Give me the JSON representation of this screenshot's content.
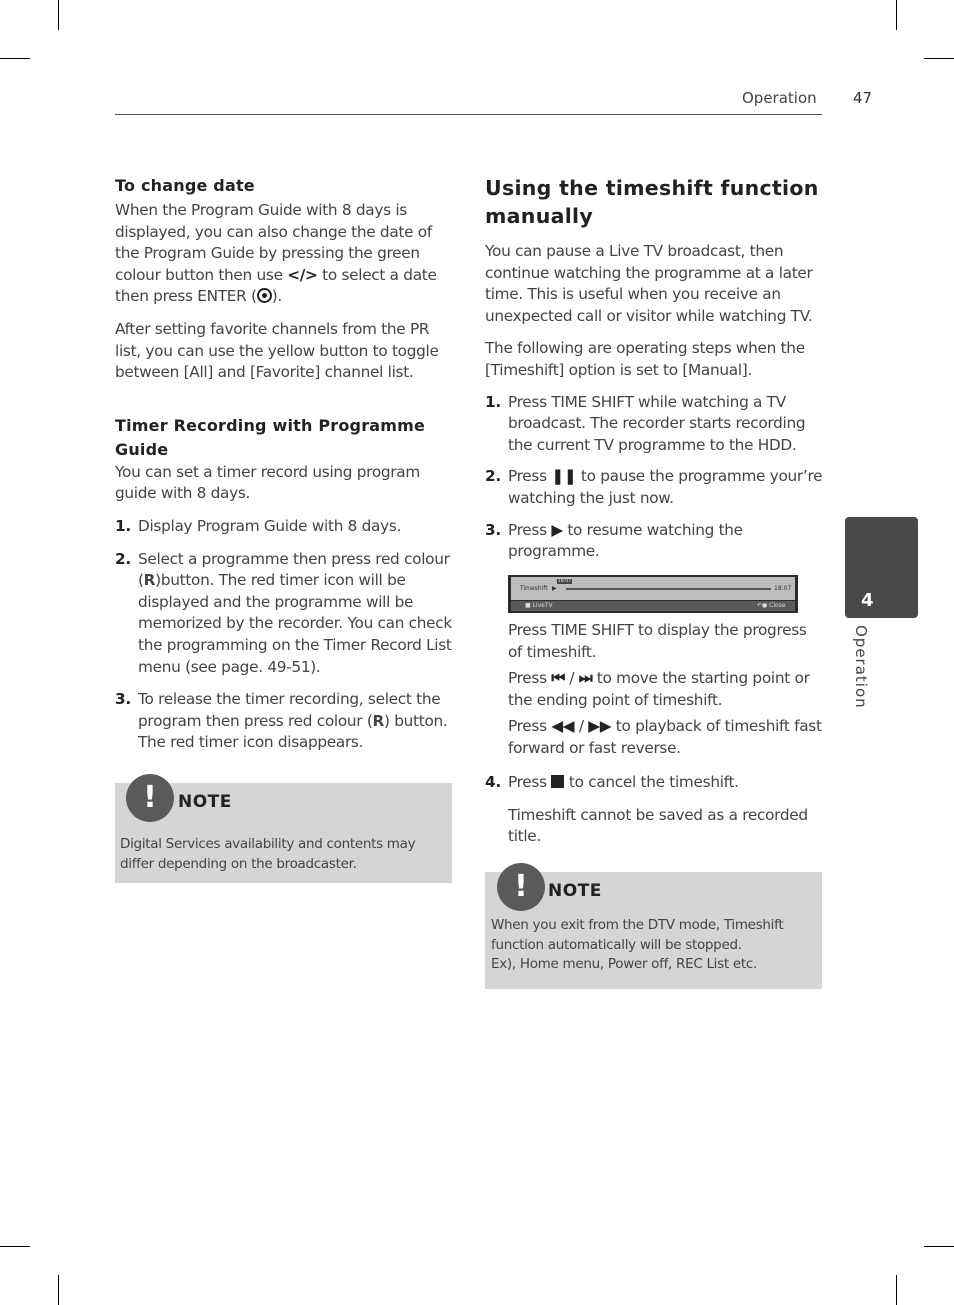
{
  "header": {
    "section": "Operation",
    "page_number": "47"
  },
  "side_tab": {
    "number": "4",
    "label": "Operation"
  },
  "left": {
    "change_date": {
      "heading": "To change date",
      "para1_a": "When the Program Guide with 8 days is displayed, you can also change the date of the Program Guide by pressing the green colour button then use ",
      "para1_glyph": "</>",
      "para1_b": " to select a date then press ENTER (",
      "para1_c": ").",
      "para2": "After setting favorite channels from the PR list, you can use the yellow button to toggle between [All] and [Favorite] channel list."
    },
    "timer": {
      "heading": "Timer Recording with Programme Guide",
      "intro": "You can set a timer record using program guide with 8 days.",
      "steps": [
        {
          "num": "1.",
          "text": "Display Program Guide with 8 days."
        },
        {
          "num": "2.",
          "a": "Select a programme then press red colour (",
          "key": "R",
          "b": ")button. The red timer icon will be displayed and the programme will be memorized by the recorder. You can check the programming on the Timer Record List menu (see page. 49-51)."
        },
        {
          "num": "3.",
          "a": "To release the timer recording, select the program then press red colour (",
          "key": "R",
          "b": ") button. The red timer icon disappears."
        }
      ]
    },
    "note": {
      "icon": "!",
      "title": "NOTE",
      "text": "Digital Services availability and contents may differ depending on the broadcaster."
    }
  },
  "right": {
    "heading": "Using the timeshift function manually",
    "para1": "You can pause a Live TV broadcast, then continue watching the programme at a later time. This is useful when you receive an unexpected call or visitor while watching TV.",
    "para2": "The following are operating steps when the [Timeshift] option is set to [Manual].",
    "steps": [
      {
        "num": "1.",
        "text": "Press TIME SHIFT while watching a TV broadcast. The recorder starts recording the current TV programme to the HDD."
      },
      {
        "num": "2.",
        "a": "Press ",
        "glyph": "❚❚",
        "b": " to pause the programme your’re watching the just now."
      },
      {
        "num": "3.",
        "a": "Press ",
        "glyph": "▶",
        "b": " to resume watching the programme."
      }
    ],
    "osd": {
      "label": "Timeshift",
      "play": "▶",
      "marker": "18:07",
      "time": "18:07",
      "live": "■  LiveTV",
      "close": "↶● Close",
      "progress": 0.02
    },
    "sub": [
      {
        "text": "Press TIME SHIFT to display the progress of timeshift."
      },
      {
        "a": "Press ",
        "glyph1": "⏮",
        "sep": " / ",
        "glyph2": "⏭",
        "b": " to move the starting point or the ending point of timeshift."
      },
      {
        "a": "Press ",
        "glyph1": "◀◀",
        "sep": " / ",
        "glyph2": "▶▶",
        "b": " to playback of timeshift fast forward or fast reverse."
      }
    ],
    "step4": {
      "num": "4.",
      "a": "Press ",
      "b": " to cancel the timeshift."
    },
    "step4_note": "Timeshift cannot be saved as a recorded title.",
    "note": {
      "icon": "!",
      "title": "NOTE",
      "line1": "When you exit from the DTV mode, Timeshift",
      "line2": "function automatically will be stopped.",
      "line3": "Ex), Home menu, Power off, REC List etc."
    }
  }
}
